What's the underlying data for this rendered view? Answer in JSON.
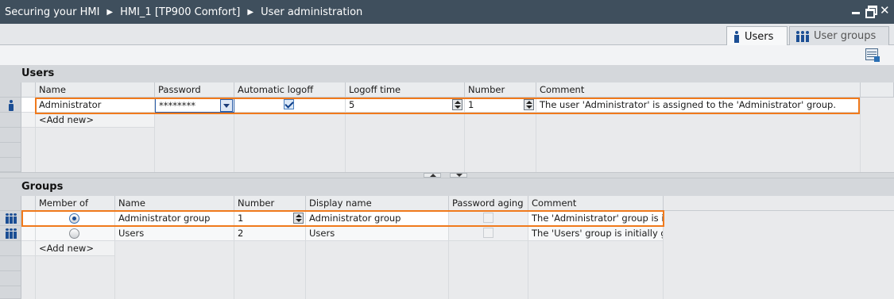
{
  "breadcrumb": [
    "Securing your HMI",
    "HMI_1 [TP900 Comfort]",
    "User administration"
  ],
  "window_buttons": {
    "minimize": "minimize",
    "restore": "restore",
    "close": "✕"
  },
  "tabs": [
    {
      "label": "Users",
      "icon": "user-icon",
      "active": true
    },
    {
      "label": "User groups",
      "icon": "user-groups-icon",
      "active": false
    }
  ],
  "toolbar": {
    "icon": "table-settings-icon"
  },
  "users": {
    "title": "Users",
    "columns": [
      "Name",
      "Password",
      "Automatic logoff",
      "Logoff time",
      "Number",
      "Comment"
    ],
    "rows": [
      {
        "name": "Administrator",
        "password": "********",
        "automatic_logoff": true,
        "logoff_time": "5",
        "number": "1",
        "comment": "The user 'Administrator' is assigned to the 'Administrator' group."
      }
    ],
    "add_new": "<Add new>"
  },
  "groups": {
    "title": "Groups",
    "columns": [
      "Member of",
      "Name",
      "Number",
      "Display name",
      "Password aging",
      "Comment"
    ],
    "rows": [
      {
        "member_of": true,
        "name": "Administrator group",
        "number": "1",
        "display_name": "Administrator group",
        "password_aging": false,
        "comment": "The 'Administrator' group is i..."
      },
      {
        "member_of": false,
        "name": "Users",
        "number": "2",
        "display_name": "Users",
        "password_aging": false,
        "comment": "The 'Users' group is initially g..."
      }
    ],
    "add_new": "<Add new>"
  },
  "colors": {
    "titlebar": "#3f4f5d",
    "highlight": "#f07a1c",
    "accent": "#1b4e94"
  }
}
